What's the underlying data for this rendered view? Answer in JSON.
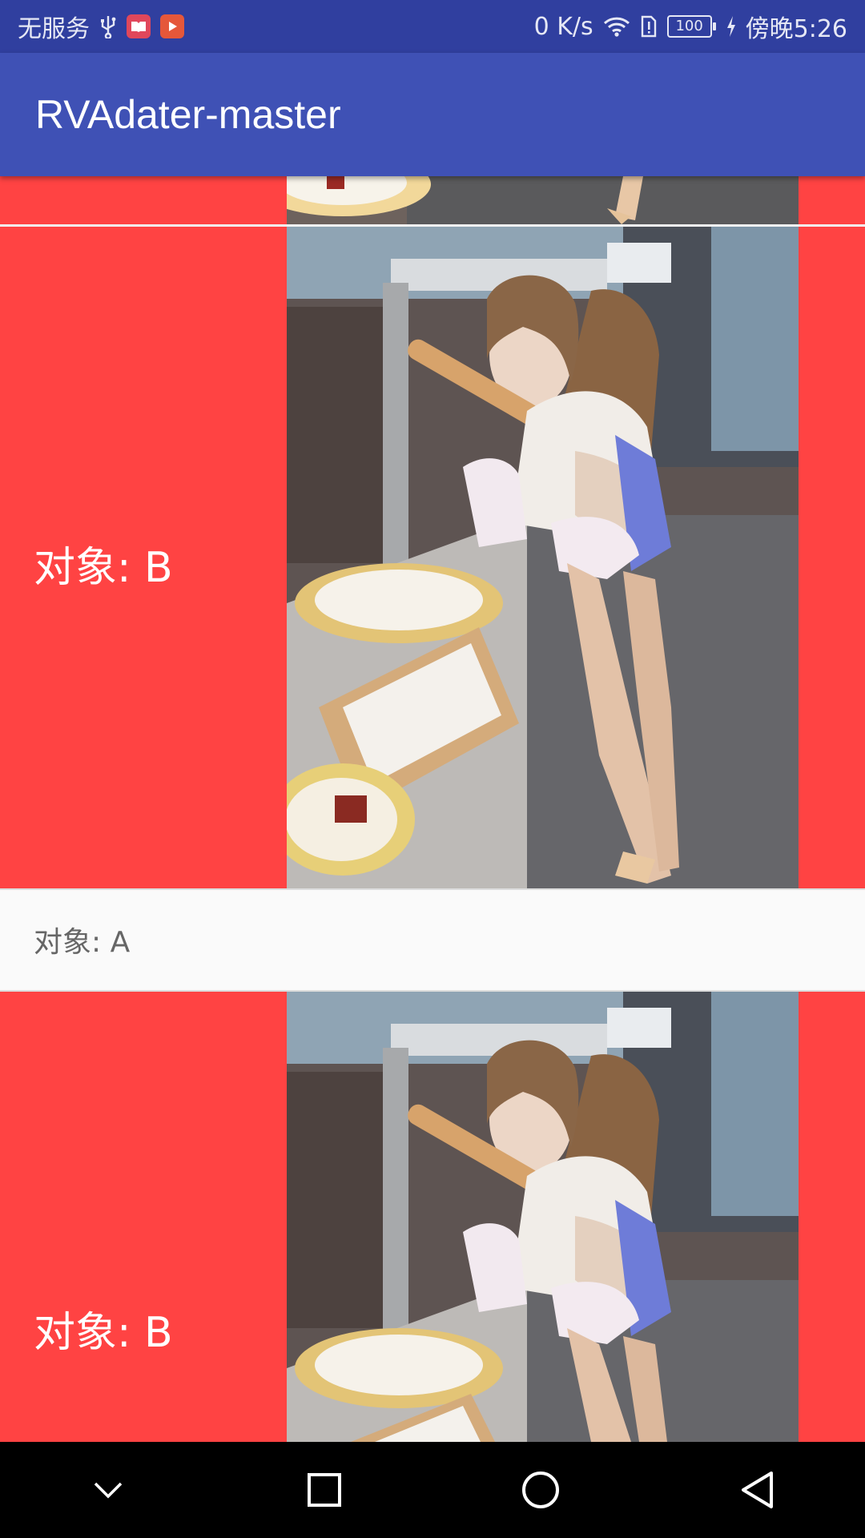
{
  "status_bar": {
    "carrier": "无服务",
    "net_speed": "0 K/s",
    "battery": "100",
    "time": "傍晚5:26"
  },
  "app_bar": {
    "title": "RVAdater-master"
  },
  "list": {
    "items": [
      {
        "type": "B",
        "label": "对象: B"
      },
      {
        "type": "A",
        "label": "对象: A"
      },
      {
        "type": "B",
        "label": "对象: B"
      }
    ]
  },
  "colors": {
    "status_bar": "#303f9f",
    "app_bar": "#3f51b5",
    "row_b_bg": "#ff4343",
    "row_a_bg": "#fafafa"
  },
  "icons": {
    "status_left": [
      "usb-icon",
      "book-app-icon",
      "video-app-icon"
    ],
    "status_right": [
      "wifi-icon",
      "sim-alert-icon",
      "battery-icon",
      "charging-icon"
    ],
    "nav": [
      "chevron-down-icon",
      "recents-square-icon",
      "home-circle-icon",
      "back-triangle-icon"
    ]
  }
}
